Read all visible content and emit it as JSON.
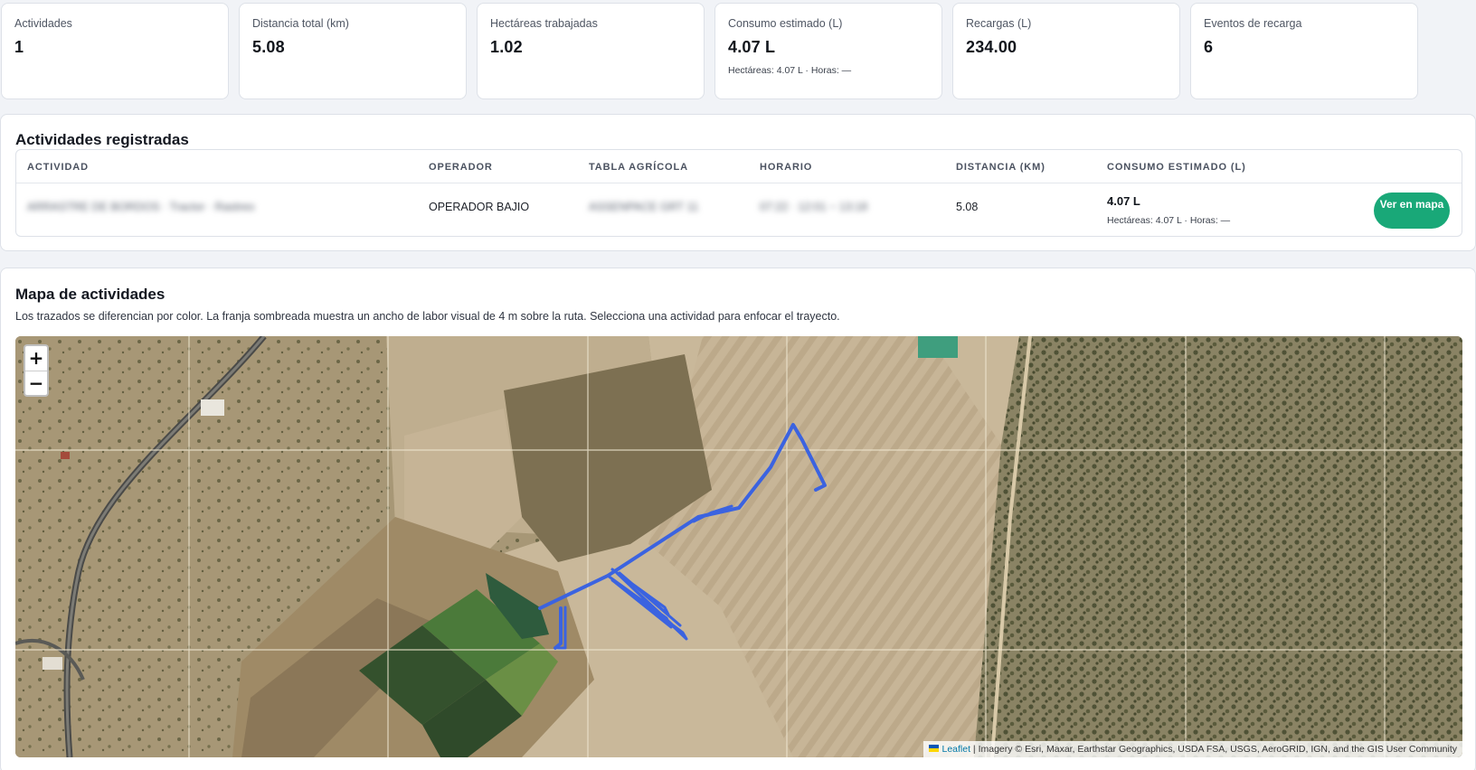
{
  "cards": [
    {
      "label": "Actividades",
      "value": "1",
      "sub": ""
    },
    {
      "label": "Distancia total (km)",
      "value": "5.08",
      "sub": ""
    },
    {
      "label": "Hectáreas trabajadas",
      "value": "1.02",
      "sub": ""
    },
    {
      "label": "Consumo estimado (L)",
      "value": "4.07 L",
      "sub": "Hectáreas: 4.07 L · Horas: —"
    },
    {
      "label": "Recargas (L)",
      "value": "234.00",
      "sub": ""
    },
    {
      "label": "Eventos de recarga",
      "value": "6",
      "sub": ""
    }
  ],
  "activities": {
    "title": "Actividades registradas",
    "columns": [
      "Actividad",
      "Operador",
      "Tabla agrícola",
      "Horario",
      "Distancia (km)",
      "Consumo estimado (L)"
    ],
    "rows": [
      {
        "activity": "ARRASTRE DE BORDOS · Tractor · Rastreo",
        "operator": "OPERADOR BAJIO",
        "table": "ASSENPACE GRT 11",
        "schedule": "07:22 · 12:01 ~ 13:18",
        "distance": "5.08",
        "consumption": "4.07 L",
        "consumption_detail": "Hectáreas: 4.07 L · Horas: —",
        "action": "Ver en mapa"
      }
    ]
  },
  "map_section": {
    "title": "Mapa de actividades",
    "description": "Los trazados se diferencian por color. La franja sombreada muestra un ancho de labor visual de 4 m sobre la ruta. Selecciona una actividad para enfocar el trayecto.",
    "zoom_in": "+",
    "zoom_out": "−",
    "attribution_link": "Leaflet",
    "attribution_text": " | Imagery © Esri, Maxar, Earthstar Geographics, USDA FSA, USGS, AeroGRID, IGN, and the GIS User Community",
    "route_color": "#3b63e0"
  }
}
